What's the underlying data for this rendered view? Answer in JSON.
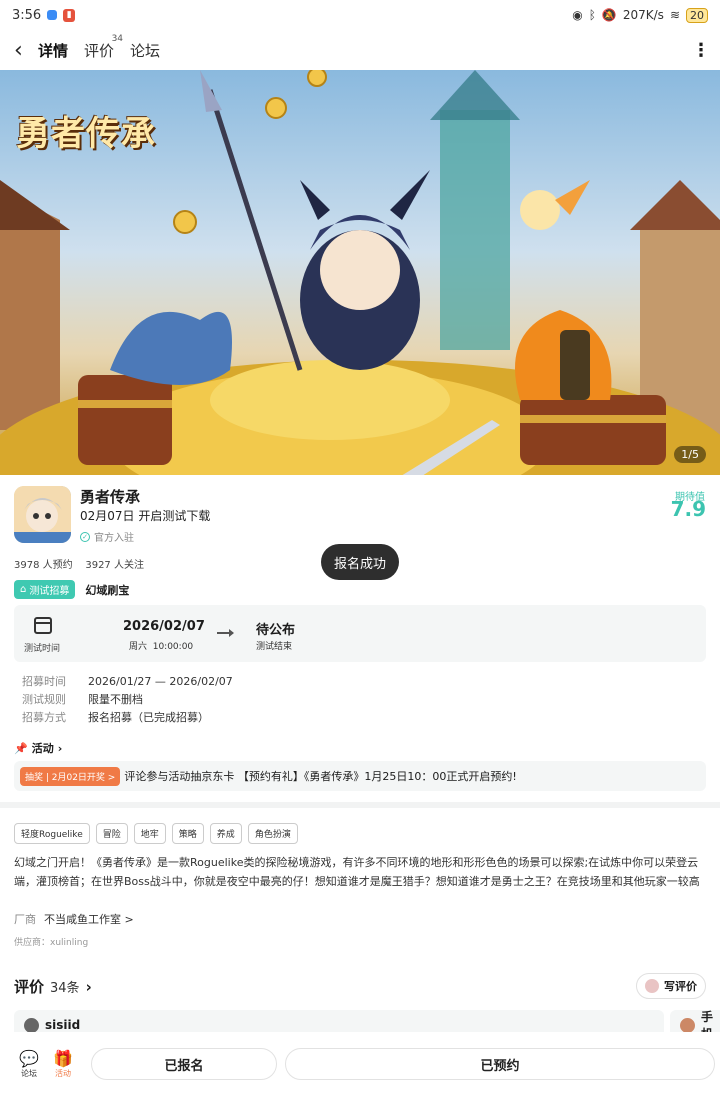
{
  "status_bar": {
    "time": "3:56",
    "net_speed": "207K/s",
    "battery": "20"
  },
  "nav": {
    "back_icon": "chevron-left-icon",
    "tabs": [
      {
        "label": "详情",
        "active": true
      },
      {
        "label": "评价",
        "badge": "34"
      },
      {
        "label": "论坛"
      }
    ],
    "more_icon": "more-vertical-icon"
  },
  "banner": {
    "logo_text": "勇者传承",
    "page_indicator": "1/5"
  },
  "game": {
    "title": "勇者传承",
    "date_line": "02月07日 开启测试下载",
    "official": "官方入驻",
    "score_label": "期待值",
    "score": "7.9",
    "stats": "3978 人预约    3927 人关注"
  },
  "toast": "报名成功",
  "recruit": {
    "tag": "测试招募",
    "name": "幻域刷宝",
    "test_time_label": "测试时间",
    "start_date": "2026/02/07",
    "start_time": "周六  10:00:00",
    "end_label": "待公布",
    "end_sub": "测试结束",
    "rows": [
      {
        "key": "招募时间",
        "value": "2026/01/27 — 2026/02/07"
      },
      {
        "key": "测试规则",
        "value": "限量不删档"
      },
      {
        "key": "招募方式",
        "value": "报名招募（已完成招募）"
      }
    ]
  },
  "activity": {
    "heading": "活动",
    "tag": "抽奖 | 2月02日开奖 >",
    "text": "评论参与活动抽京东卡 【预约有礼】《勇者传承》1月25日10：00正式开启预约!"
  },
  "tags": [
    "轻度Roguelike",
    "冒险",
    "地牢",
    "策略",
    "养成",
    "角色扮演"
  ],
  "description": "幻域之门开启！《勇者传承》是一款Roguelike类的探险秘境游戏，有许多不同环境的地形和形形色色的场景可以探索;在试炼中你可以荣登云端，灌顶榜首；在世界Boss战斗中，你就是夜空中最亮的仔！想知道谁才是魔王猎手？想知道谁才是勇士之王？在竞技场里和其他玩家一较高下看看谁荣登顶峰。「超爽地牢刷宝」百层地牢迷宫关卡，上百种怪物及精英怪和几十种Boss。冒险装备全靠打！每20层更换一套装备，每次掉落装备属性完...",
  "developer": {
    "label": "厂商",
    "name": "不当咸鱼工作室 >"
  },
  "supplier": "供应商：xulinling",
  "reviews": {
    "title": "评价",
    "count": "34条",
    "write_label": "写评价",
    "first_user": "sisiid",
    "second_user": "手机"
  },
  "bottom_bar": {
    "forum_label": "论坛",
    "activity_label": "活动",
    "signed_up": "已报名",
    "reserved": "已预约"
  }
}
